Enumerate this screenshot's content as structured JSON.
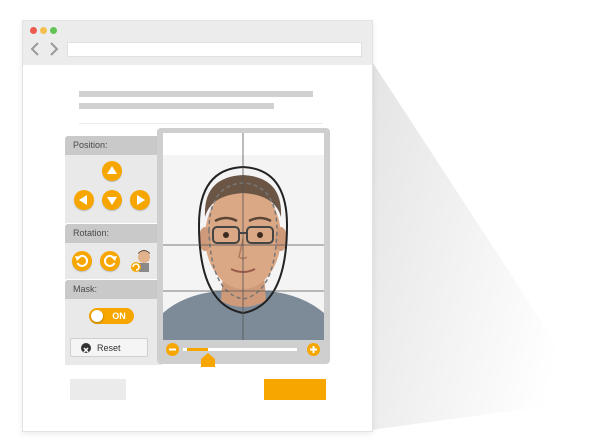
{
  "browser": {
    "back_icon": "chevron-left-icon",
    "forward_icon": "chevron-right-icon",
    "address": ""
  },
  "sidebar": {
    "position_label": "Position:",
    "rotation_label": "Rotation:",
    "mask_label": "Mask:",
    "position_buttons": [
      "arrow-up-icon",
      "arrow-left-icon",
      "arrow-down-icon",
      "arrow-right-icon"
    ],
    "rotation_buttons": [
      "rotate-left-icon",
      "rotate-right-icon",
      "auto-rotate-face-icon"
    ],
    "mask_toggle": {
      "label": "ON",
      "on": true
    },
    "reset_label": "Reset"
  },
  "editor": {
    "zoom_fraction": 0.22,
    "zoom_out_icon": "minus-icon",
    "zoom_in_icon": "plus-icon"
  },
  "footer": {
    "secondary_button": "",
    "primary_button": ""
  },
  "colors": {
    "accent": "#f7a600",
    "panel_header": "#c9c9c9",
    "panel_body": "#e9e9e9"
  }
}
